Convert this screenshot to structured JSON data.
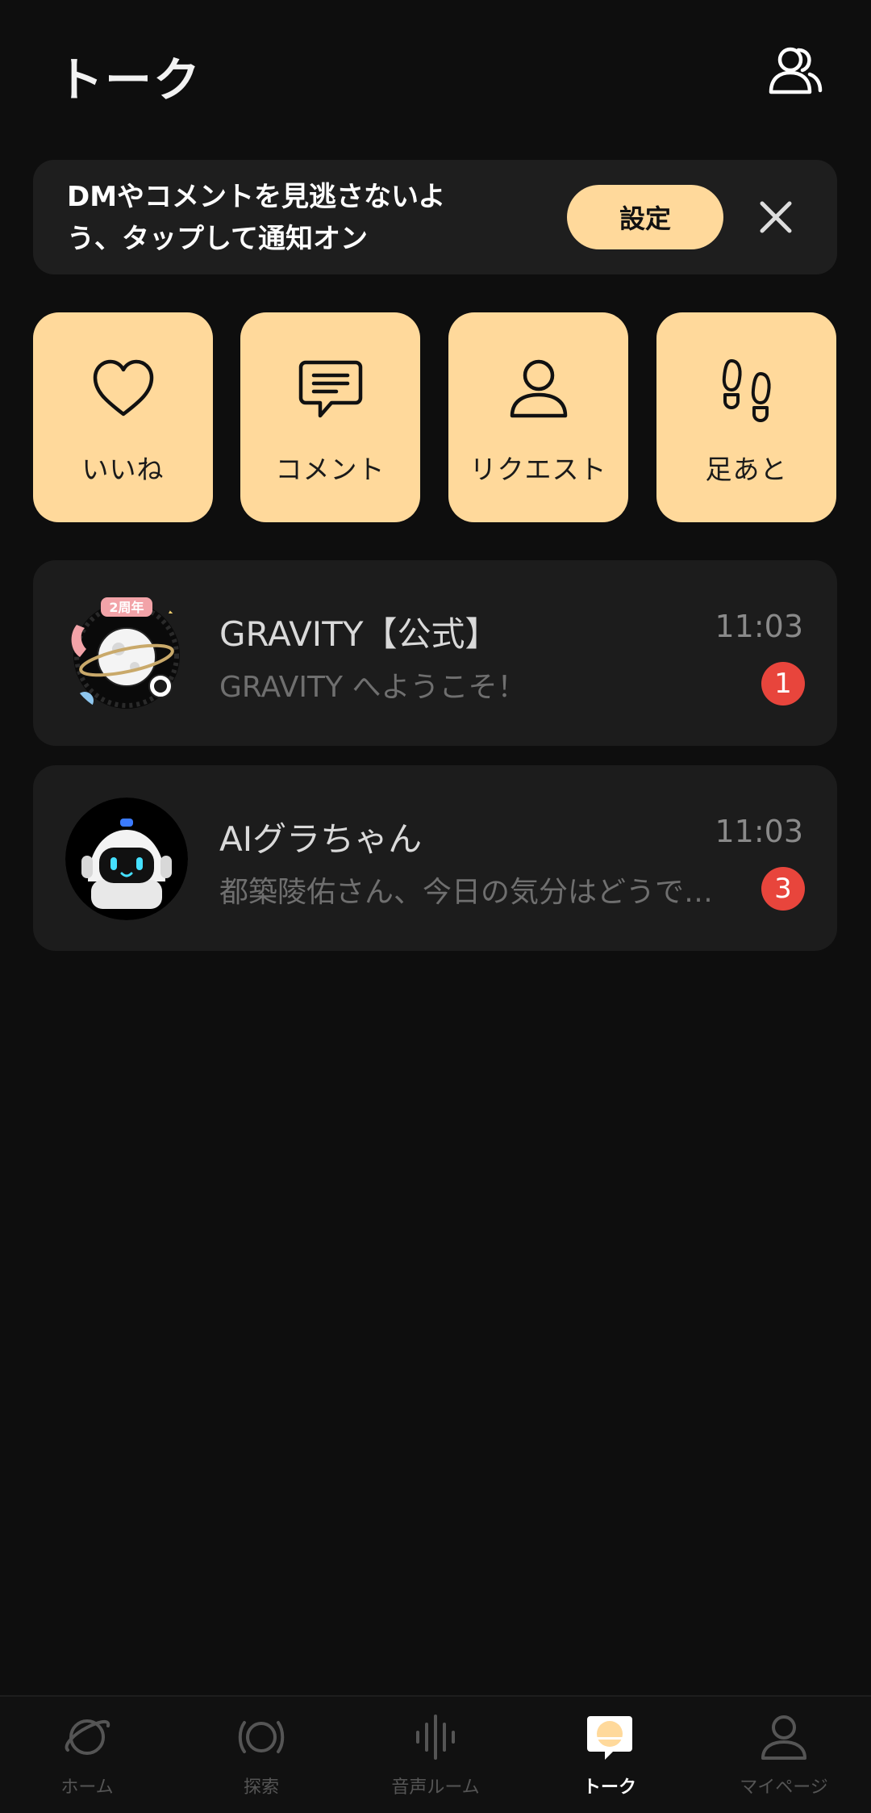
{
  "header": {
    "title": "トーク",
    "friends_icon": "people-icon"
  },
  "banner": {
    "line1": "DMやコメントを見逃さないよ",
    "line2": "う、タップして通知オン",
    "button_label": "設定",
    "close_icon": "close-icon"
  },
  "shortcuts": [
    {
      "label": "いいね",
      "icon": "heart-icon"
    },
    {
      "label": "コメント",
      "icon": "comment-icon"
    },
    {
      "label": "リクエスト",
      "icon": "person-icon"
    },
    {
      "label": "足あと",
      "icon": "footprints-icon"
    }
  ],
  "chats": [
    {
      "name": "GRAVITY【公式】",
      "time": "11:03",
      "preview": "GRAVITY へようこそ！",
      "badge": "1",
      "avatar_text": "2周年"
    },
    {
      "name": "AIグラちゃん",
      "time": "11:03",
      "preview": "都築陵佑さん、今日の気分はどうで…",
      "badge": "3"
    }
  ],
  "nav": {
    "items": [
      {
        "label": "ホーム",
        "icon": "planet-icon",
        "active": false
      },
      {
        "label": "探索",
        "icon": "explore-icon",
        "active": false
      },
      {
        "label": "音声ルーム",
        "icon": "voice-wave-icon",
        "active": false
      },
      {
        "label": "トーク",
        "icon": "chat-bubble-icon",
        "active": true
      },
      {
        "label": "マイページ",
        "icon": "profile-icon",
        "active": false
      }
    ]
  },
  "colors": {
    "background": "#0e0e0e",
    "card": "#1c1c1c",
    "accent": "#ffd99b",
    "badge": "#e8453c"
  }
}
